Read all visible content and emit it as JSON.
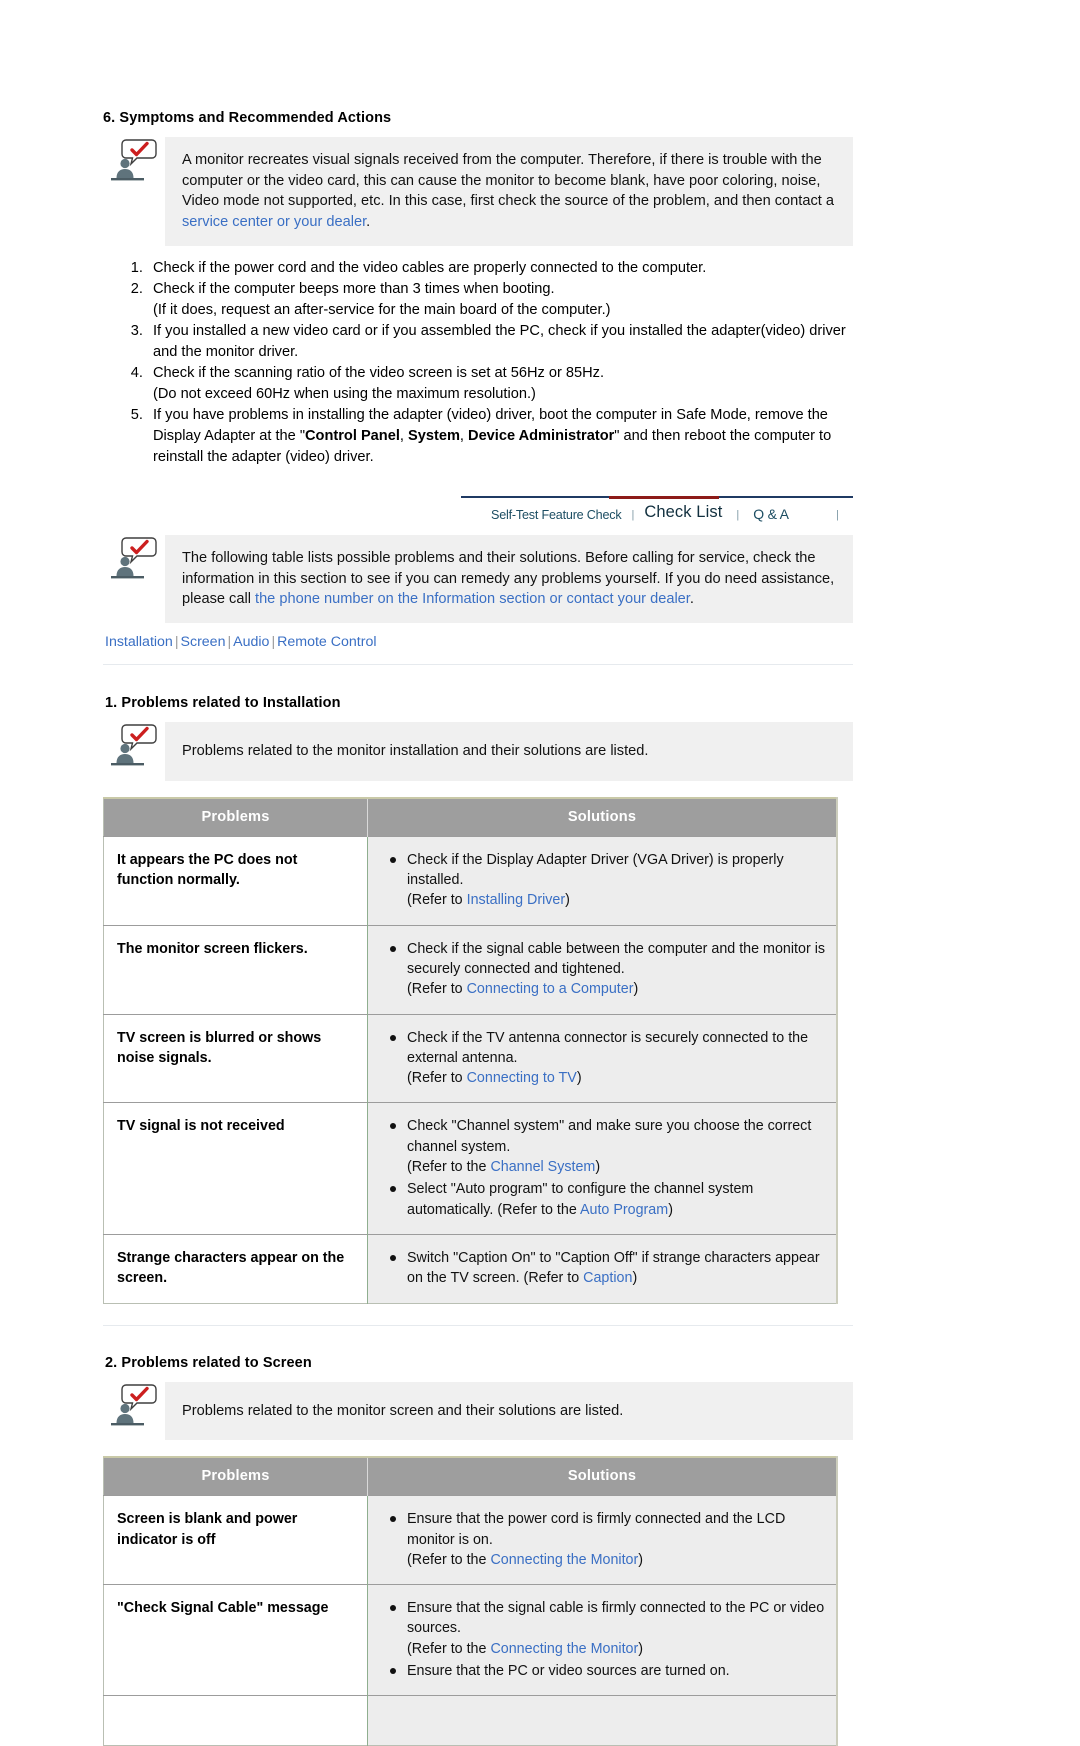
{
  "section6": {
    "heading": "6. Symptoms and Recommended Actions",
    "note": {
      "icon": "person-check-bubble-icon",
      "text_before": "A monitor recreates visual signals received from the computer. Therefore, if there is trouble with the computer or the video card, this can cause the monitor to become blank, have poor coloring, noise, Video mode not supported, etc. In this case, first check the source of the problem, and then contact a ",
      "link": "service center or your dealer",
      "text_after": "."
    },
    "steps": [
      {
        "main": "Check if the power cord and the video cables are properly connected to the computer."
      },
      {
        "main": "Check if the computer beeps more than 3 times when booting.",
        "sub": "(If it does, request an after-service for the main board of the computer.)"
      },
      {
        "main": "If you installed a new video card or if you assembled the PC, check if you installed the adapter(video) driver and the monitor driver."
      },
      {
        "main": "Check if the scanning ratio of the video screen is set at 56Hz or 85Hz.",
        "sub": "(Do not exceed 60Hz when using the maximum resolution.)"
      },
      {
        "main_p1": "If you have problems in installing the adapter (video) driver, boot the computer in Safe Mode, remove the Display Adapter at the \"",
        "bold1": "Control Panel",
        "mid1": ", ",
        "bold2": "System",
        "mid2": ", ",
        "bold3": "Device Administrator",
        "main_p2": "\" and then reboot the computer to reinstall the adapter (video) driver."
      }
    ]
  },
  "tabs": {
    "items": [
      {
        "label": "Self-Test Feature Check",
        "active": false
      },
      {
        "label": "Check List",
        "active": true
      },
      {
        "label": "Q & A",
        "active": false
      }
    ],
    "separator": "|",
    "accent_color": "#8d1b18",
    "border_color": "#1f3a63",
    "text_color": "#1d4e63"
  },
  "intro_note": {
    "icon": "person-check-bubble-icon",
    "text_before": "The following table lists possible problems and their solutions. Before calling for service, check the information in this section to see if you can remedy any problems yourself. If you do need assistance, please call ",
    "link": "the phone number on the Information section or contact your dealer",
    "text_after": "."
  },
  "navlinks": {
    "items": [
      "Installation",
      "Screen",
      "Audio",
      "Remote Control"
    ],
    "separator": "|",
    "color": "#3a6fc4"
  },
  "table_columns": {
    "problems": "Problems",
    "solutions": "Solutions"
  },
  "section_installation": {
    "heading": "1. Problems related to Installation",
    "note_text": "Problems related to the monitor installation and their solutions are listed.",
    "rows": [
      {
        "problem": "It appears the PC does not function normally.",
        "bullets": [
          {
            "pre": "Check if the Display Adapter Driver (VGA Driver) is properly installed.",
            "refer_pre": "(Refer to ",
            "refer_link": "Installing Driver",
            "refer_post": ")"
          }
        ]
      },
      {
        "problem": "The monitor screen flickers.",
        "bullets": [
          {
            "pre": "Check if the signal cable between the computer and the monitor is securely connected and tightened.",
            "refer_pre": "(Refer to ",
            "refer_link": "Connecting to a Computer",
            "refer_post": ")"
          }
        ]
      },
      {
        "problem": "TV screen is blurred or shows noise signals.",
        "bullets": [
          {
            "pre": "Check if the TV antenna connector is securely connected to the external antenna.",
            "refer_pre": "(Refer to ",
            "refer_link": "Connecting to TV",
            "refer_post": ")"
          }
        ]
      },
      {
        "problem": "TV signal is not received",
        "bullets": [
          {
            "pre": "Check \"Channel system\" and make sure you choose the correct channel system.",
            "refer_pre": "(Refer to the ",
            "refer_link": "Channel System",
            "refer_post": ")"
          },
          {
            "pre": "Select \"Auto program\" to configure the channel system automatically. (Refer to the ",
            "refer_link": "Auto Program",
            "refer_post": ")",
            "inline": true
          }
        ]
      },
      {
        "problem": "Strange characters appear on the screen.",
        "bullets": [
          {
            "pre": "Switch \"Caption On\" to \"Caption Off\" if strange characters appear on the TV screen. (Refer to ",
            "refer_link": "Caption",
            "refer_post": ")",
            "inline": true
          }
        ]
      }
    ]
  },
  "section_screen": {
    "heading": "2. Problems related to Screen",
    "note_text": "Problems related to the monitor screen and their solutions are listed.",
    "rows": [
      {
        "problem": "Screen is blank and power indicator is off",
        "bullets": [
          {
            "pre": "Ensure that the power cord is firmly connected and the LCD monitor is on.",
            "refer_pre": "(Refer to the ",
            "refer_link": "Connecting the Monitor",
            "refer_post": ")"
          }
        ]
      },
      {
        "problem": "\"Check Signal Cable\" message",
        "bullets": [
          {
            "pre": "Ensure that the signal cable is firmly connected to the PC or video sources.",
            "refer_pre": "(Refer to the ",
            "refer_link": "Connecting the Monitor",
            "refer_post": ")"
          },
          {
            "pre": "Ensure that the PC or video sources are turned on."
          }
        ]
      },
      {
        "problem": "",
        "bullets": [],
        "partial": true
      }
    ]
  }
}
